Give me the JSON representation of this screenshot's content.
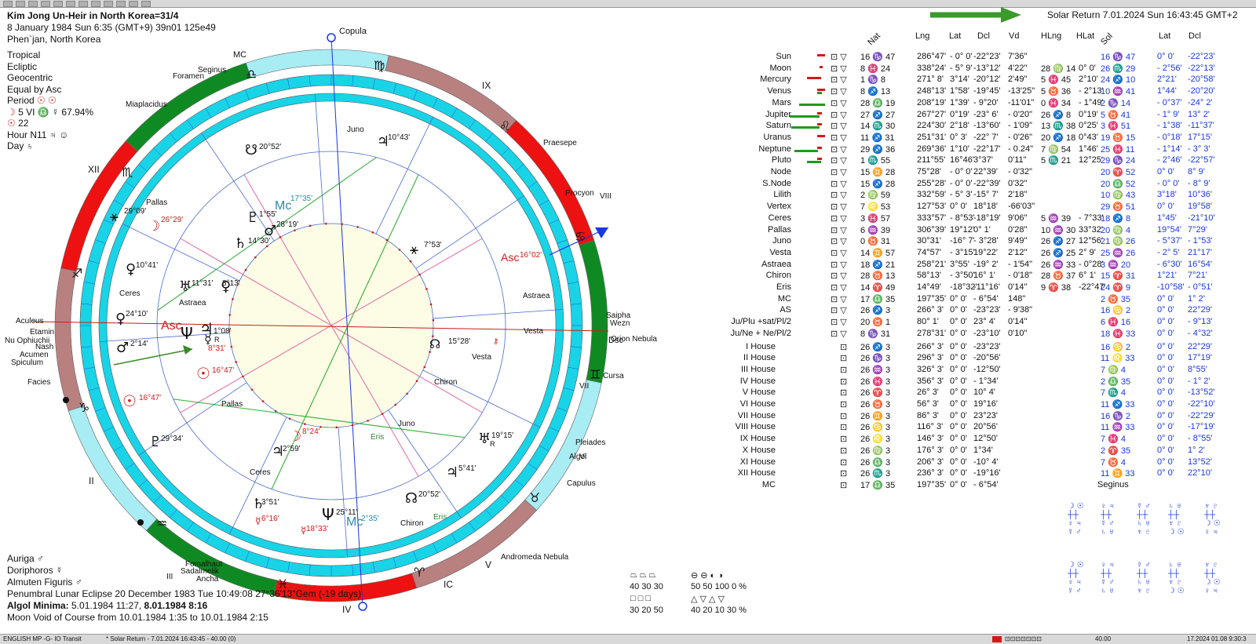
{
  "toolbar": {
    "buttons": [
      "new",
      "open",
      "save",
      "print",
      "chart",
      "wheel",
      "table",
      "aspects",
      "transit",
      "close",
      "help",
      "exit"
    ]
  },
  "header": {
    "title": "Kim Jong Un-Heir in North Korea=31/4",
    "line2": "8 January 1984  Sun  6:35 (GMT+9) 39n01  125e49",
    "line3": "Phen`jan, North Korea"
  },
  "settings": {
    "zodiac": "Tropical",
    "coord": "Ecliptic",
    "centric": "Geocentric",
    "houses": "Equal by Asc",
    "period": "Period",
    "period_val": "5 VI ♎ ☿ 67.94%",
    "val22": "22",
    "hour": "Hour N11",
    "day": "Day"
  },
  "solar_return": {
    "title": "Solar Return  7.01.2024  Sun 16:43:45 GMT+2"
  },
  "table": {
    "headers": {
      "nat": "Nat",
      "lng": "Lng",
      "lat": "Lat",
      "dcl": "Dcl",
      "vd": "Vd",
      "hlng": "HLng",
      "hlat": "HLat",
      "sol": "Sol",
      "lat2": "Lat",
      "dcl2": "Dcl"
    },
    "planets": [
      {
        "name": "Sun",
        "a": "16 ♑ 47",
        "lng": "286°47'",
        "lat": "- 0° 0'",
        "dcl": "-22°23'",
        "vd": "7'36\"",
        "hl": "",
        "hlat": "",
        "s": "16 ♑ 47",
        "slat": "0° 0'",
        "sdcl": "-22°23'"
      },
      {
        "name": "Moon",
        "a": "8 ♓ 24",
        "lng": "338°24'",
        "lat": "- 5° 9'",
        "dcl": "-13°12'",
        "vd": "4'22\"",
        "hl": "28 ♍ 14",
        "hlat": "0° 0'",
        "s": "26 ♏ 29",
        "slat": "- 2°56'",
        "sdcl": "-22°13'"
      },
      {
        "name": "Mercury",
        "a": "1 ♑ 8",
        "lng": "271° 8'",
        "lat": "3°14'",
        "dcl": "-20°12'",
        "vd": "2'49\"",
        "hl": "5 ♓ 45",
        "hlat": "2°10'",
        "s": "24 ♐ 10",
        "slat": "2°21'",
        "sdcl": "-20°58'"
      },
      {
        "name": "Venus",
        "a": "8 ♐ 13",
        "lng": "248°13'",
        "lat": "1°58'",
        "dcl": "-19°45'",
        "vd": "-13'25\"",
        "hl": "5 ♉ 36",
        "hlat": "- 2°13'",
        "s": "10 ♒ 41",
        "slat": "1°44'",
        "sdcl": "-20°20'"
      },
      {
        "name": "Mars",
        "a": "28 ♎ 19",
        "lng": "208°19'",
        "lat": "1°39'",
        "dcl": "- 9°20'",
        "vd": "-11'01\"",
        "hl": "0 ♓ 34",
        "hlat": "- 1°49'",
        "s": "2 ♑ 14",
        "slat": "- 0°37'",
        "sdcl": "-24° 2'"
      },
      {
        "name": "Jupiter",
        "a": "27 ♐ 27",
        "lng": "267°27'",
        "lat": "0°19'",
        "dcl": "-23° 6'",
        "vd": "- 0'20\"",
        "hl": "26 ♐ 8",
        "hlat": "0°19'",
        "s": "5 ♉ 41",
        "slat": "- 1° 9'",
        "sdcl": "13° 2'"
      },
      {
        "name": "Saturn",
        "a": "14 ♏ 30",
        "lng": "224°30'",
        "lat": "2°18'",
        "dcl": "-13°60'",
        "vd": "- 1'09\"",
        "hl": "13 ♏ 38",
        "hlat": "0°25'",
        "s": "3 ♓ 51",
        "slat": "- 1°38'",
        "sdcl": "-11°37'"
      },
      {
        "name": "Uranus",
        "a": "11 ♐ 31",
        "lng": "251°31'",
        "lat": "0° 3'",
        "dcl": "-22° 7'",
        "vd": "- 0'26\"",
        "hl": "20 ♐ 18",
        "hlat": "0°43'",
        "s": "19 ♉ 15",
        "slat": "- 0°18'",
        "sdcl": "17°15'"
      },
      {
        "name": "Neptune",
        "a": "29 ♐ 36",
        "lng": "269°36'",
        "lat": "1°10'",
        "dcl": "-22°17'",
        "vd": "- 0.24\"",
        "hl": "7 ♍ 54",
        "hlat": "1°46'",
        "s": "25 ♓ 11",
        "slat": "- 1°14'",
        "sdcl": "- 3° 3'"
      },
      {
        "name": "Pluto",
        "a": "1 ♏ 55",
        "lng": "211°55'",
        "lat": "16°46'",
        "dcl": "3°37'",
        "vd": "0'11\"",
        "hl": "5 ♏ 21",
        "hlat": "12°25'",
        "s": "29 ♑ 24",
        "slat": "- 2°46'",
        "sdcl": "-22°57'"
      },
      {
        "name": "Node",
        "a": "15 ♊ 28",
        "lng": "75°28'",
        "lat": "- 0° 0'",
        "dcl": "22°39'",
        "vd": "- 0'32\"",
        "hl": "",
        "hlat": "",
        "s": "20 ♈ 52",
        "slat": "0° 0'",
        "sdcl": "8° 9'"
      },
      {
        "name": "S.Node",
        "a": "15 ♐ 28",
        "lng": "255°28'",
        "lat": "- 0° 0'",
        "dcl": "-22°39'",
        "vd": "0'32\"",
        "hl": "",
        "hlat": "",
        "s": "20 ♎ 52",
        "slat": "- 0° 0'",
        "sdcl": "- 8° 9'"
      },
      {
        "name": "Lilith",
        "a": "2 ♍ 59",
        "lng": "332°59'",
        "lat": "- 5° 3'",
        "dcl": "-15° 7'",
        "vd": "2'18\"",
        "hl": "",
        "hlat": "",
        "s": "10 ♍ 43",
        "slat": "3°18'",
        "sdcl": "10°36'"
      },
      {
        "name": "Vertex",
        "a": "7 ♌ 53",
        "lng": "127°53'",
        "lat": "0° 0'",
        "dcl": "18°18'",
        "vd": "-66'03\"",
        "hl": "",
        "hlat": "",
        "s": "29 ♉ 51",
        "slat": "0° 0'",
        "sdcl": "19°58'"
      },
      {
        "name": "Ceres",
        "a": "3 ♓ 57",
        "lng": "333°57'",
        "lat": "- 8°53'",
        "dcl": "-18°19'",
        "vd": "9'06\"",
        "hl": "5 ♒ 39",
        "hlat": "- 7°33'",
        "s": "18 ♐ 8",
        "slat": "1°45'",
        "sdcl": "-21°10'"
      },
      {
        "name": "Pallas",
        "a": "6 ♒ 39",
        "lng": "306°39'",
        "lat": "19°12'",
        "dcl": "0° 1'",
        "vd": "0'28\"",
        "hl": "10 ♒ 30",
        "hlat": "33°32'",
        "s": "20 ♍ 4",
        "slat": "19°54'",
        "sdcl": "7°29'"
      },
      {
        "name": "Juno",
        "a": "0 ♉ 31",
        "lng": "30°31'",
        "lat": "-16° 7'",
        "dcl": "- 3°28'",
        "vd": "9'49\"",
        "hl": "26 ♐ 27",
        "hlat": "12°56'",
        "s": "21 ♍ 26",
        "slat": "- 5°37'",
        "sdcl": "- 1°53'"
      },
      {
        "name": "Vesta",
        "a": "14 ♊ 57",
        "lng": "74°57'",
        "lat": "- 3°15'",
        "dcl": "19°22'",
        "vd": "2'12\"",
        "hl": "26 ♐ 25",
        "hlat": "2° 9'",
        "s": "25 ♒ 26",
        "slat": "- 2° 5'",
        "sdcl": "21°17'"
      },
      {
        "name": "Astraea",
        "a": "18 ♐ 21",
        "lng": "258°21'",
        "lat": "3°55'",
        "dcl": "-19° 2'",
        "vd": "- 1'54\"",
        "hl": "26 ♒ 33",
        "hlat": "- 0°28'",
        "s": "3 ♒ 20",
        "slat": "- 6°30'",
        "sdcl": "16°54'"
      },
      {
        "name": "Chiron",
        "a": "28 ♉ 13",
        "lng": "58°13'",
        "lat": "- 3°50'",
        "dcl": "16° 1'",
        "vd": "- 0'18\"",
        "hl": "28 ♉ 37",
        "hlat": "6° 1'",
        "s": "15 ♈ 31",
        "slat": "1°21'",
        "sdcl": "7°21'"
      },
      {
        "name": "Eris",
        "a": "14 ♈ 49",
        "lng": "14°49'",
        "lat": "-18°32'",
        "dcl": "-11°16'",
        "vd": "0'14\"",
        "hl": "9 ♈ 38",
        "hlat": "-22°47'",
        "s": "24 ♈ 9",
        "slat": "-10°58'",
        "sdcl": "- 0°51'"
      },
      {
        "name": "MC",
        "a": "17 ♎ 35",
        "lng": "197°35'",
        "lat": "0° 0'",
        "dcl": "- 6°54'",
        "vd": "148\"",
        "hl": "",
        "hlat": "",
        "s": "2 ♉ 35",
        "slat": "0° 0'",
        "sdcl": "1° 2'"
      },
      {
        "name": "AS",
        "a": "26 ♐ 3",
        "lng": "266° 3'",
        "lat": "0° 0'",
        "dcl": "-23°23'",
        "vd": "- 9'38\"",
        "hl": "",
        "hlat": "",
        "s": "16 ♋ 2",
        "slat": "0° 0'",
        "sdcl": "22°29'"
      },
      {
        "name": "Ju/Plu +sat/Pl/2",
        "a": "20 ♉ 1",
        "lng": "80° 1'",
        "lat": "0° 0'",
        "dcl": "23° 4'",
        "vd": "0'14\"",
        "hl": "",
        "hlat": "",
        "s": "6 ♓ 16",
        "slat": "0° 0'",
        "sdcl": "- 9°13'"
      },
      {
        "name": "Ju/Ne + Ne/Pl/2",
        "a": "8 ♑ 31",
        "lng": "278°31'",
        "lat": "0° 0'",
        "dcl": "-23°10'",
        "vd": "0'10\"",
        "hl": "",
        "hlat": "",
        "s": "18 ♓ 33",
        "slat": "0° 0'",
        "sdcl": "- 4°32'"
      }
    ],
    "houses": [
      {
        "name": "I House",
        "a": "26 ♐ 3",
        "lng": "266° 3'",
        "lat": "0° 0'",
        "dcl": "-23°23'",
        "s": "16 ♋ 2",
        "slat": "0° 0'",
        "sdcl": "22°29'"
      },
      {
        "name": "II House",
        "a": "26 ♑ 3",
        "lng": "296° 3'",
        "lat": "0° 0'",
        "dcl": "-20°56'",
        "s": "11 ♌ 33",
        "slat": "0° 0'",
        "sdcl": "17°19'"
      },
      {
        "name": "III House",
        "a": "26 ♒ 3",
        "lng": "326° 3'",
        "lat": "0° 0'",
        "dcl": "-12°50'",
        "s": "7 ♍ 4",
        "slat": "0° 0'",
        "sdcl": "8°55'"
      },
      {
        "name": "IV House",
        "a": "26 ♓ 3",
        "lng": "356° 3'",
        "lat": "0° 0'",
        "dcl": "- 1°34'",
        "s": "2 ♎ 35",
        "slat": "0° 0'",
        "sdcl": "- 1° 2'"
      },
      {
        "name": "V House",
        "a": "26 ♈ 3",
        "lng": "26° 3'",
        "lat": "0° 0'",
        "dcl": "10° 4'",
        "s": "7 ♏ 4",
        "slat": "0° 0'",
        "sdcl": "-13°52'"
      },
      {
        "name": "VI House",
        "a": "26 ♉ 3",
        "lng": "56° 3'",
        "lat": "0° 0'",
        "dcl": "19°16'",
        "s": "11 ♐ 33",
        "slat": "0° 0'",
        "sdcl": "-22°10'"
      },
      {
        "name": "VII House",
        "a": "26 ♊ 3",
        "lng": "86° 3'",
        "lat": "0° 0'",
        "dcl": "23°23'",
        "s": "16 ♑ 2",
        "slat": "0° 0'",
        "sdcl": "-22°29'"
      },
      {
        "name": "VIII House",
        "a": "26 ♋ 3",
        "lng": "116° 3'",
        "lat": "0° 0'",
        "dcl": "20°56'",
        "s": "11 ♒ 33",
        "slat": "0° 0'",
        "sdcl": "-17°19'"
      },
      {
        "name": "IX House",
        "a": "26 ♌ 3",
        "lng": "146° 3'",
        "lat": "0° 0'",
        "dcl": "12°50'",
        "s": "7 ♓ 4",
        "slat": "0° 0'",
        "sdcl": "- 8°55'"
      },
      {
        "name": "X House",
        "a": "26 ♍ 3",
        "lng": "176° 3'",
        "lat": "0° 0'",
        "dcl": "1°34'",
        "s": "2 ♈ 35",
        "slat": "0° 0'",
        "sdcl": "1° 2'"
      },
      {
        "name": "XI House",
        "a": "26 ♎ 3",
        "lng": "206° 3'",
        "lat": "0° 0'",
        "dcl": "-10° 4'",
        "s": "7 ♉ 4",
        "slat": "0° 0'",
        "sdcl": "13°52'"
      },
      {
        "name": "XII House",
        "a": "26 ♏ 3",
        "lng": "236° 3'",
        "lat": "0° 0'",
        "dcl": "-19°16'",
        "s": "11 ♊ 33",
        "slat": "0° 0'",
        "sdcl": "22°10'"
      },
      {
        "name": "MC",
        "a": "17 ♎ 35",
        "lng": "197°35'",
        "lat": "0° 0'",
        "dcl": "- 6°54'",
        "s": "",
        "slat": "",
        "sdcl": ""
      }
    ],
    "seginus": "Seginus"
  },
  "wheel": {
    "stars_outer": [
      "Copula",
      "MC",
      "Seginus",
      "Foramen",
      "Miaplacidus",
      "IX",
      "Praesepe",
      "XII",
      "Procyon",
      "VIII",
      "Saipha",
      "Wezn",
      "Aculeus",
      "Etamin",
      "Nu Ophiuchii",
      "Nash",
      "Acumen",
      "Spiculum",
      "Asc",
      "Dsc",
      "Orion Nebula",
      "Facies",
      "Cursa",
      "Pleiades",
      "Algol",
      "VI",
      "Capulus",
      "II",
      "Andromeda Nebula",
      "V",
      "Fomalhaut",
      "Sadalmelik",
      "Ancha",
      "IC",
      "IV",
      "III",
      "VII"
    ],
    "inner_labels": [
      "Juno",
      "10°43'",
      "20°52'",
      "Mc 17°35'",
      "1°55'",
      "28°19'",
      "14°30'",
      "Pallas",
      "29°09'",
      "26°29'",
      "10°41'",
      "Ceres",
      "11°31'",
      "8°13'",
      "Astraea",
      "24°10'",
      "Asc",
      "1°08'",
      "R",
      "8°31'",
      "2°14'",
      "16°47'",
      "16°47'",
      "Pallas",
      "29°34'",
      "7°53'",
      "Asc 16°02'",
      "Astraea",
      "Vesta",
      "15°28'",
      "Vesta",
      "Chiron",
      "Juno",
      "Eris",
      "19°15'",
      "R",
      "8°24'",
      "2°59'",
      "Ceres",
      "5°41'",
      "20°52'",
      "3°51'",
      "6°16'",
      "25°11'",
      "18°33'",
      "Mc 2°35'",
      "Chiron",
      "Eris"
    ]
  },
  "bottom": {
    "line1": "Auriga  ♂",
    "line2": "Doriphoros  ☿",
    "line3": "Almuten Figuris  ♂",
    "line4": "Penumbral Lunar Eclipse 20 December 1983 Tue 10:49:08 27°36'13\"Gem (-19 days)",
    "line5_label": "Algol Minima:",
    "line5_val": " 5.01.1984 11:27,  ",
    "line5_bold": "8.01.1984  8:16",
    "line6": "Moon Void of Course from 10.01.1984  1:35 to 10.01.1984  2:15"
  },
  "aspect_stats": {
    "row1": "40  30  30",
    "row1b": "50  50  100 0 %",
    "row2": "30  20  50",
    "row2b": "40  20  10  30 %"
  },
  "status": {
    "left": "ENGLISH MP -G- IO Transit",
    "mid": "* Solar Return - 7.01.2024 16:43:45 - 40.00 (0)",
    "right1": "40.00",
    "right2": "17.2024 01.08 9:30:3"
  },
  "colors": {
    "fire": "#ee1111",
    "earth": "#b98080",
    "air": "#a8ecf4",
    "water": "#0f8a22",
    "inner": "#19d3e6",
    "blue": "#1a37e0"
  }
}
